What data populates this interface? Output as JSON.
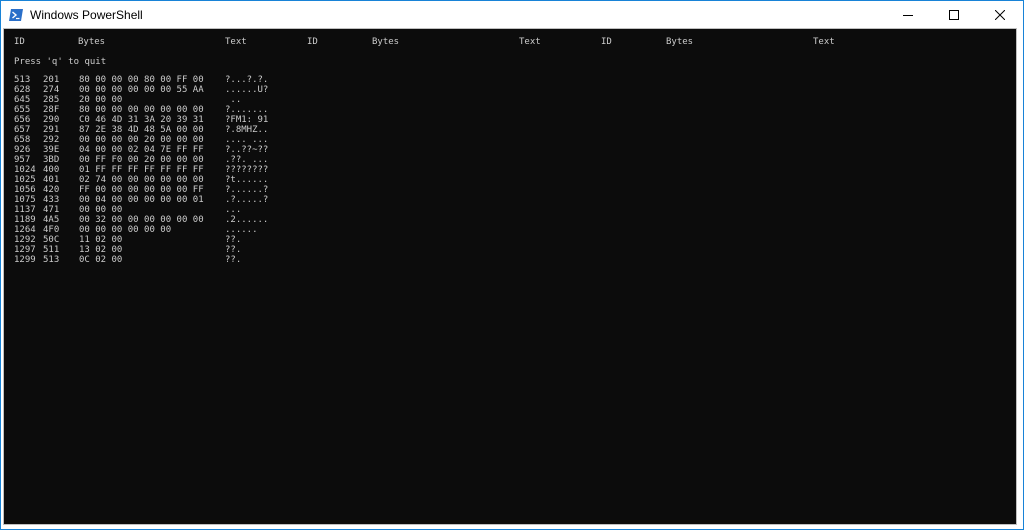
{
  "window": {
    "title": "Windows PowerShell",
    "icon": "powershell-icon",
    "controls": [
      "minimize-icon",
      "maximize-icon",
      "close-icon"
    ],
    "colors": {
      "console_bg": "#0c0c0c",
      "console_text": "#cccccc",
      "border": "#1883d7"
    }
  },
  "console": {
    "headers": [
      "ID",
      "Bytes",
      "Text",
      "ID",
      "Bytes",
      "Text",
      "ID",
      "Bytes",
      "Text"
    ],
    "prompt": "Press 'q' to quit",
    "rows": [
      {
        "id": "513",
        "hex": "201",
        "bytes": "80 00 00 00 80 00 FF 00",
        "text": "?...?.?."
      },
      {
        "id": "628",
        "hex": "274",
        "bytes": "00 00 00 00 00 00 55 AA",
        "text": "......U?"
      },
      {
        "id": "645",
        "hex": "285",
        "bytes": "20 00 00",
        "text": " .."
      },
      {
        "id": "655",
        "hex": "28F",
        "bytes": "80 00 00 00 00 00 00 00",
        "text": "?......."
      },
      {
        "id": "656",
        "hex": "290",
        "bytes": "C0 46 4D 31 3A 20 39 31",
        "text": "?FM1: 91"
      },
      {
        "id": "657",
        "hex": "291",
        "bytes": "87 2E 38 4D 48 5A 00 00",
        "text": "?.8MHZ.."
      },
      {
        "id": "658",
        "hex": "292",
        "bytes": "00 00 00 00 20 00 00 00",
        "text": ".... ..."
      },
      {
        "id": "926",
        "hex": "39E",
        "bytes": "04 00 00 02 04 7E FF FF",
        "text": "?..??~??"
      },
      {
        "id": "957",
        "hex": "3BD",
        "bytes": "00 FF F0 00 20 00 00 00",
        "text": ".??. ..."
      },
      {
        "id": "1024",
        "hex": "400",
        "bytes": "01 FF FF FF FF FF FF FF",
        "text": "????????"
      },
      {
        "id": "1025",
        "hex": "401",
        "bytes": "02 74 00 00 00 00 00 00",
        "text": "?t......"
      },
      {
        "id": "1056",
        "hex": "420",
        "bytes": "FF 00 00 00 00 00 00 FF",
        "text": "?......?"
      },
      {
        "id": "1075",
        "hex": "433",
        "bytes": "00 04 00 00 00 00 00 01",
        "text": ".?.....?"
      },
      {
        "id": "1137",
        "hex": "471",
        "bytes": "00 00 00",
        "text": "..."
      },
      {
        "id": "1189",
        "hex": "4A5",
        "bytes": "00 32 00 00 00 00 00 00",
        "text": ".2......"
      },
      {
        "id": "1264",
        "hex": "4F0",
        "bytes": "00 00 00 00 00 00",
        "text": "......"
      },
      {
        "id": "1292",
        "hex": "50C",
        "bytes": "11 02 00",
        "text": "??."
      },
      {
        "id": "1297",
        "hex": "511",
        "bytes": "13 02 00",
        "text": "??."
      },
      {
        "id": "1299",
        "hex": "513",
        "bytes": "0C 02 00",
        "text": "??."
      }
    ]
  }
}
